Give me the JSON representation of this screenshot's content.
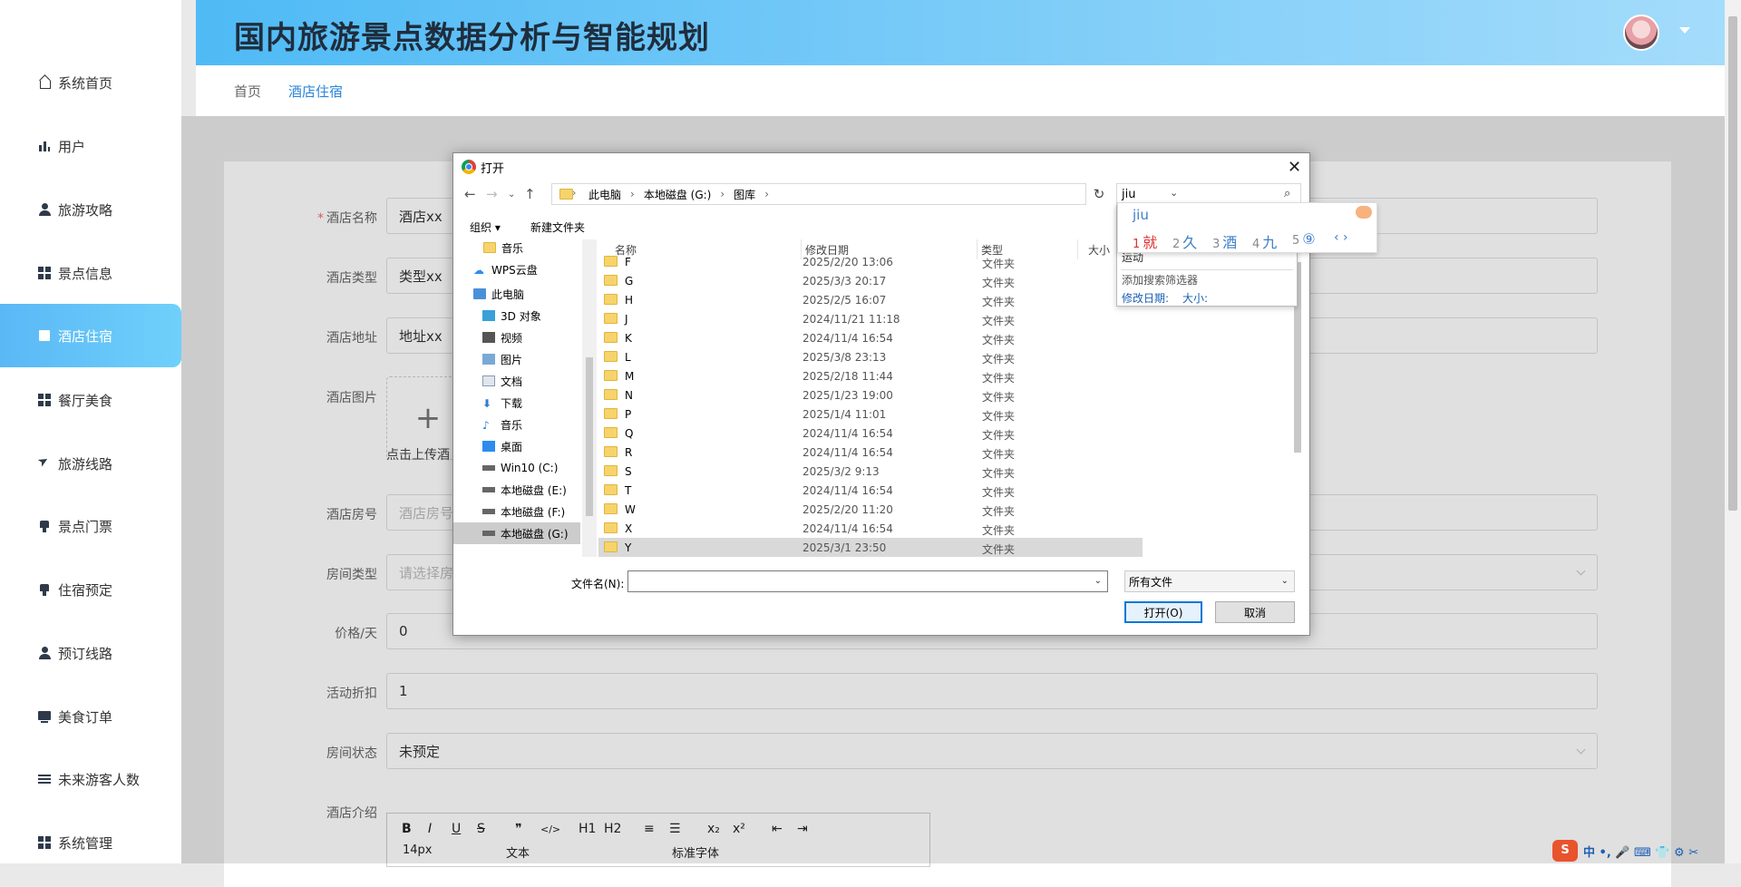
{
  "sidebar": {
    "items": [
      {
        "label": "系统首页",
        "icon": "home-icon"
      },
      {
        "label": "用户",
        "icon": "bar-chart-icon"
      },
      {
        "label": "旅游攻略",
        "icon": "user-icon"
      },
      {
        "label": "景点信息",
        "icon": "grid-icon"
      },
      {
        "label": "酒店住宿",
        "icon": "book-icon"
      },
      {
        "label": "餐厅美食",
        "icon": "grid-icon"
      },
      {
        "label": "旅游线路",
        "icon": "plane-icon"
      },
      {
        "label": "景点门票",
        "icon": "ticket-icon"
      },
      {
        "label": "住宿预定",
        "icon": "ticket-icon"
      },
      {
        "label": "预订线路",
        "icon": "user-icon"
      },
      {
        "label": "美食订单",
        "icon": "screen-icon"
      },
      {
        "label": "未来游客人数",
        "icon": "list-icon"
      },
      {
        "label": "系统管理",
        "icon": "grid-icon"
      }
    ],
    "active_color": "#5ab8f5"
  },
  "header": {
    "title": "国内旅游景点数据分析与智能规划"
  },
  "breadcrumb": {
    "home": "首页",
    "current": "酒店住宿"
  },
  "form": {
    "hotel_name": {
      "label": "酒店名称",
      "value": "酒店xx"
    },
    "hotel_type": {
      "label": "酒店类型",
      "value": "类型xx"
    },
    "hotel_address": {
      "label": "酒店地址",
      "value": "地址xx"
    },
    "hotel_image": {
      "label": "酒店图片",
      "upload_plus": "+",
      "tip": "点击上传酒"
    },
    "room_number": {
      "label": "酒店房号",
      "placeholder": "酒店房号"
    },
    "room_type": {
      "label": "房间类型",
      "placeholder": "请选择房"
    },
    "price": {
      "label": "价格/天",
      "value": "0"
    },
    "discount": {
      "label": "活动折扣",
      "value": "1"
    },
    "room_status": {
      "label": "房间状态",
      "value": "未预定"
    },
    "intro": {
      "label": "酒店介绍"
    },
    "editor": {
      "row1": [
        "B",
        "I",
        "U",
        "S",
        "❞",
        "</>",
        "H1",
        "H2",
        "≡",
        "☰",
        "x₂",
        "x²",
        "⇤",
        "⇥"
      ],
      "font_size": "14px",
      "text_style": "文本",
      "font": "标准字体"
    }
  },
  "dialog": {
    "title": "打开",
    "path": [
      "此电脑",
      "本地磁盘 (G:)",
      "图库"
    ],
    "search_value": "jiu",
    "organize": "组织 ▾",
    "new_folder": "新建文件夹",
    "nav_items": [
      {
        "label": "音乐",
        "icon": "folder-icon"
      },
      {
        "label": "WPS云盘",
        "icon": "cloud-icon"
      },
      {
        "label": "此电脑",
        "icon": "computer-icon"
      },
      {
        "label": "3D 对象",
        "icon": "cube-icon"
      },
      {
        "label": "视频",
        "icon": "video-icon"
      },
      {
        "label": "图片",
        "icon": "picture-icon"
      },
      {
        "label": "文档",
        "icon": "document-icon"
      },
      {
        "label": "下载",
        "icon": "download-icon"
      },
      {
        "label": "音乐",
        "icon": "music-icon"
      },
      {
        "label": "桌面",
        "icon": "desktop-icon"
      },
      {
        "label": "Win10 (C:)",
        "icon": "drive-icon"
      },
      {
        "label": "本地磁盘 (E:)",
        "icon": "drive-icon"
      },
      {
        "label": "本地磁盘 (F:)",
        "icon": "drive-icon"
      },
      {
        "label": "本地磁盘 (G:)",
        "icon": "drive-icon"
      }
    ],
    "columns": {
      "name": "名称",
      "date": "修改日期",
      "type": "类型",
      "size": "大小"
    },
    "rows": [
      {
        "name": "F",
        "date": "2025/2/20 13:06",
        "type": "文件夹"
      },
      {
        "name": "G",
        "date": "2025/3/3 20:17",
        "type": "文件夹"
      },
      {
        "name": "H",
        "date": "2025/2/5 16:07",
        "type": "文件夹"
      },
      {
        "name": "J",
        "date": "2024/11/21 11:18",
        "type": "文件夹"
      },
      {
        "name": "K",
        "date": "2024/11/4 16:54",
        "type": "文件夹"
      },
      {
        "name": "L",
        "date": "2025/3/8 23:13",
        "type": "文件夹"
      },
      {
        "name": "M",
        "date": "2025/2/18 11:44",
        "type": "文件夹"
      },
      {
        "name": "N",
        "date": "2025/1/23 19:00",
        "type": "文件夹"
      },
      {
        "name": "P",
        "date": "2025/1/4 11:01",
        "type": "文件夹"
      },
      {
        "name": "Q",
        "date": "2024/11/4 16:54",
        "type": "文件夹"
      },
      {
        "name": "R",
        "date": "2024/11/4 16:54",
        "type": "文件夹"
      },
      {
        "name": "S",
        "date": "2025/3/2 9:13",
        "type": "文件夹"
      },
      {
        "name": "T",
        "date": "2024/11/4 16:54",
        "type": "文件夹"
      },
      {
        "name": "W",
        "date": "2025/2/20 11:20",
        "type": "文件夹"
      },
      {
        "name": "X",
        "date": "2024/11/4 16:54",
        "type": "文件夹"
      },
      {
        "name": "Y",
        "date": "2025/3/1 23:50",
        "type": "文件夹"
      }
    ],
    "filename_label": "文件名(N):",
    "filename_value": "",
    "filetype": "所有文件",
    "open_button": "打开(O)",
    "cancel_button": "取消",
    "search_dropdown": {
      "hint": "运动",
      "add_filter": "添加搜索筛选器",
      "filter_date": "修改日期:",
      "filter_size": "大小:"
    }
  },
  "ime": {
    "pinyin": "jiu",
    "candidates": [
      {
        "n": "1",
        "c": "就"
      },
      {
        "n": "2",
        "c": "久"
      },
      {
        "n": "3",
        "c": "酒"
      },
      {
        "n": "4",
        "c": "九"
      },
      {
        "n": "5",
        "c": "⑨"
      }
    ],
    "nav": "‹ ›",
    "tray": "中 •, 🎤 ⌨ 👕 ⚙ ✂"
  }
}
